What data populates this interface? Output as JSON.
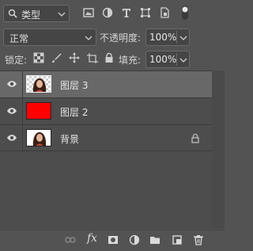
{
  "filter": {
    "kind_label": "类型",
    "icons": [
      "pixel-filter-icon",
      "adjustment-filter-icon",
      "type-filter-icon",
      "shape-filter-icon",
      "smart-object-filter-icon",
      "filter-toggle-icon"
    ]
  },
  "blend": {
    "mode": "正常",
    "opacity_label": "不透明度:",
    "opacity_value": "100%"
  },
  "locks": {
    "label": "锁定:",
    "fill_label": "填充:",
    "fill_value": "100%",
    "icons": [
      "lock-transparent-pixels-icon",
      "lock-image-pixels-icon",
      "lock-position-icon",
      "lock-artboard-icon",
      "lock-all-icon"
    ]
  },
  "layers": [
    {
      "name": "图层 3",
      "selected": true,
      "thumb": "portrait-transparent",
      "locked": false
    },
    {
      "name": "图层 2",
      "selected": false,
      "thumb": "red-fill",
      "locked": false
    },
    {
      "name": "背景",
      "selected": false,
      "thumb": "portrait",
      "locked": true
    }
  ],
  "bottom_toolbar": {
    "icons": [
      "link-layers-icon",
      "fx-icon",
      "add-mask-icon",
      "adjustment-layer-icon",
      "new-group-icon",
      "new-layer-icon",
      "delete-layer-icon"
    ],
    "fx_label": "fx"
  },
  "colors": {
    "panel_bg": "#535353",
    "selected_row": "#686868",
    "red_fill": "#ff0000"
  }
}
